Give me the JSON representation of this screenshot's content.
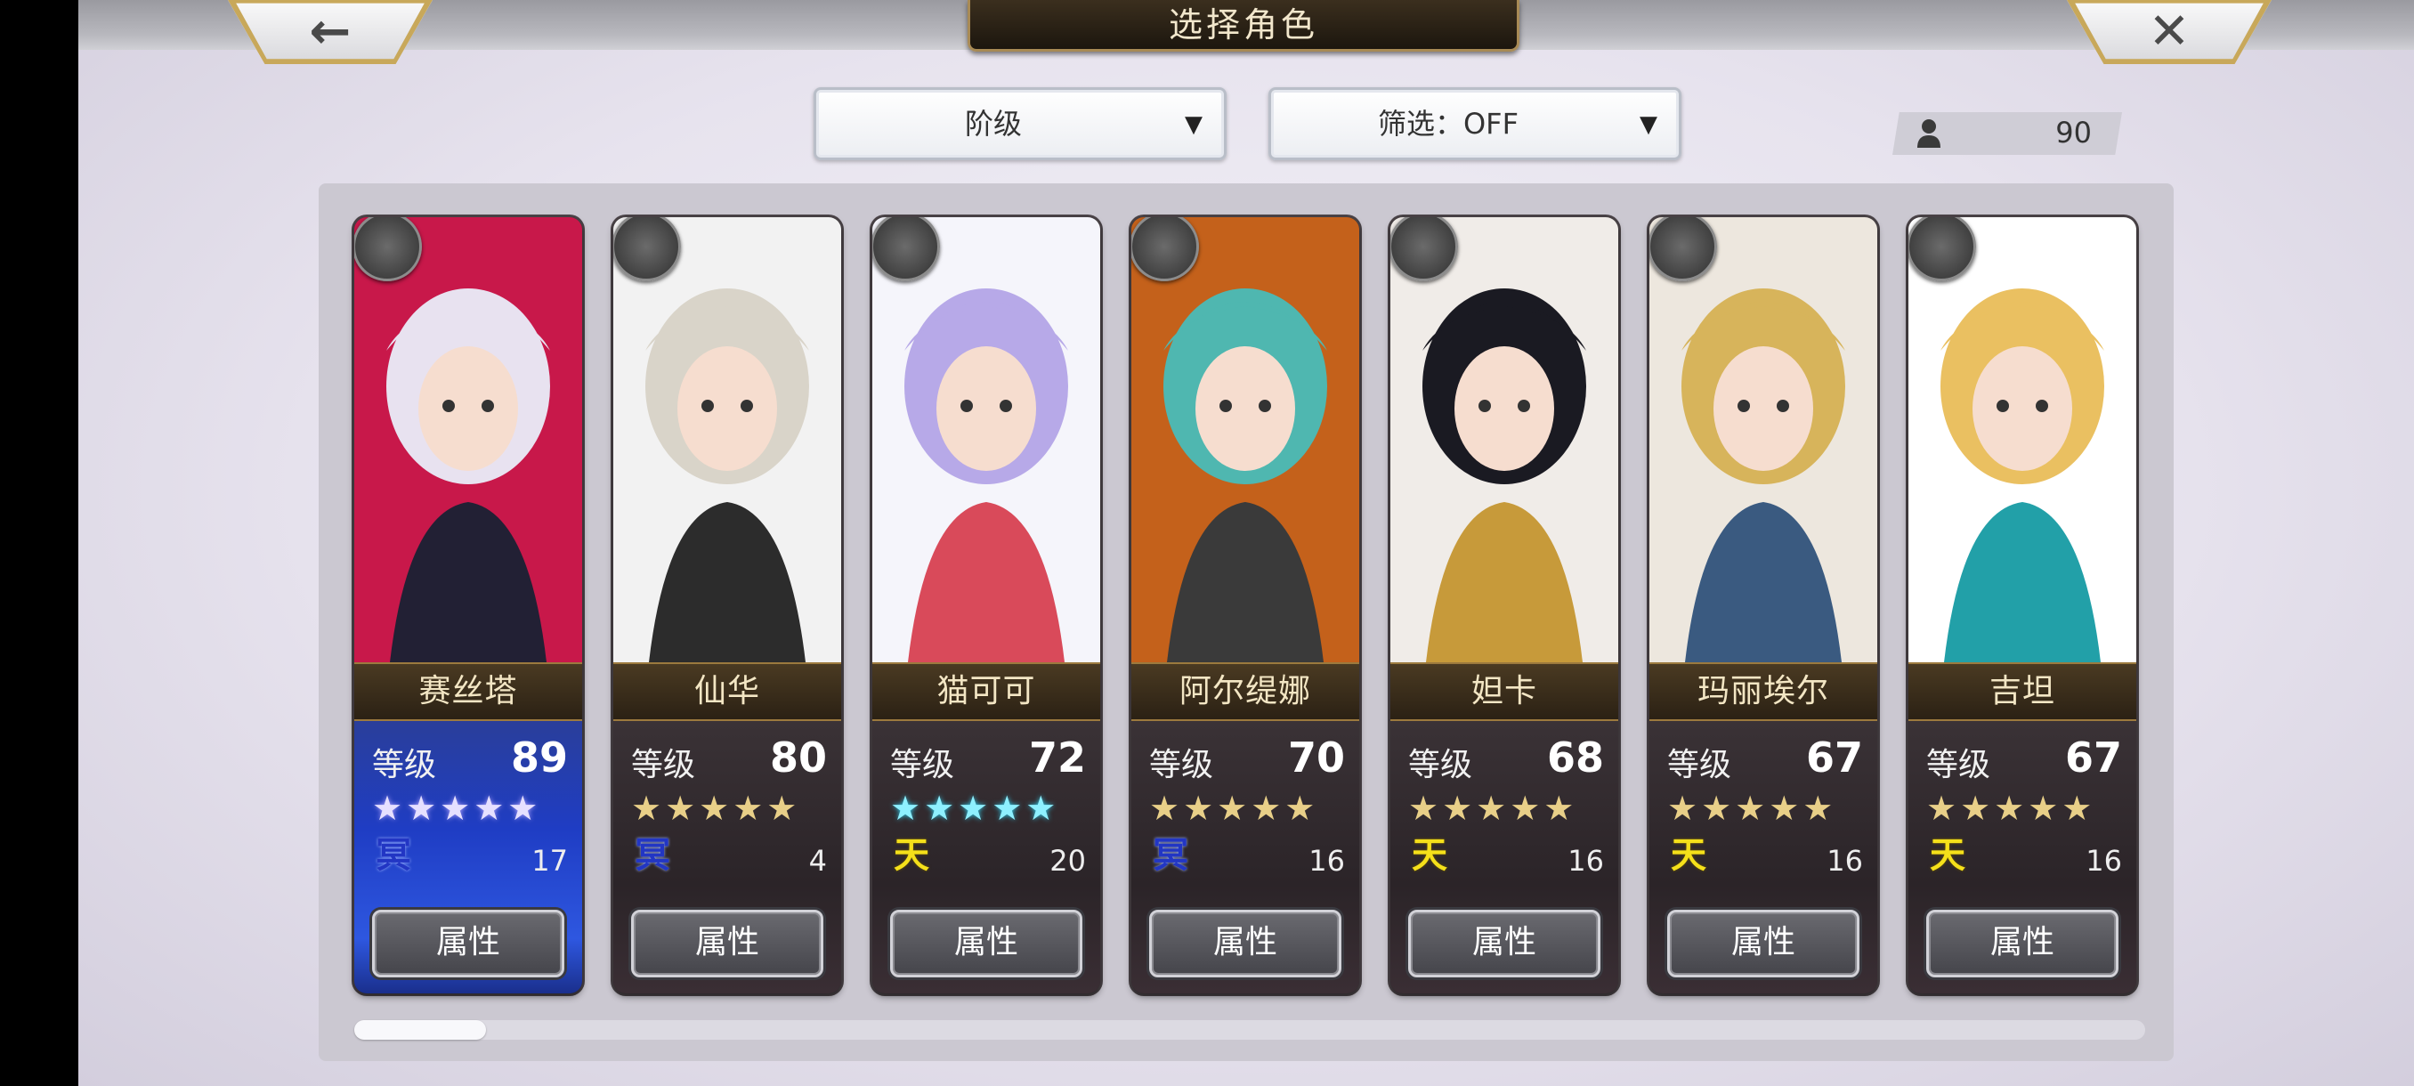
{
  "header": {
    "title": "选择角色",
    "back_icon": "back-arrow-icon",
    "close_icon": "close-x-icon"
  },
  "toolbar": {
    "sort_dropdown": {
      "selected": "阶级"
    },
    "filter_dropdown": {
      "selected": "筛选：OFF"
    },
    "roster_count": "90"
  },
  "colors": {
    "name_plate_text": "#f3e6c4",
    "heaven_element": "#f5e01a",
    "dark_element": "#2236c4",
    "cyan_star": "#8ef0ff",
    "gold_star": "#e8cf88"
  },
  "characters": [
    {
      "name": "赛丝塔",
      "level_label": "等级",
      "level": "89",
      "stars": "★★★★★",
      "star_color": "white",
      "element": "冥",
      "element_type": "dark",
      "element_count": "17",
      "attribute_label": "属性",
      "role_icon": "sword-icon"
    },
    {
      "name": "仙华",
      "level_label": "等级",
      "level": "80",
      "stars": "★★★★★",
      "star_color": "gold",
      "element": "冥",
      "element_type": "dark",
      "element_count": "4",
      "attribute_label": "属性",
      "role_icon": "staff-icon"
    },
    {
      "name": "猫可可",
      "level_label": "等级",
      "level": "72",
      "stars": "★★★★★",
      "star_color": "cyan",
      "element": "天",
      "element_type": "heaven",
      "element_count": "20",
      "attribute_label": "属性",
      "role_icon": "bow-icon"
    },
    {
      "name": "阿尔缇娜",
      "level_label": "等级",
      "level": "70",
      "stars": "★★★★★",
      "star_color": "gold",
      "element": "冥",
      "element_type": "dark",
      "element_count": "16",
      "attribute_label": "属性",
      "role_icon": "bow-icon"
    },
    {
      "name": "妲卡",
      "level_label": "等级",
      "level": "68",
      "stars": "★★★★★",
      "star_color": "gold",
      "element": "天",
      "element_type": "heaven",
      "element_count": "16",
      "attribute_label": "属性",
      "role_icon": "staff-icon"
    },
    {
      "name": "玛丽埃尔",
      "level_label": "等级",
      "level": "67",
      "stars": "★★★★★",
      "star_color": "gold",
      "element": "天",
      "element_type": "heaven",
      "element_count": "16",
      "attribute_label": "属性",
      "role_icon": "staff-icon"
    },
    {
      "name": "吉坦",
      "level_label": "等级",
      "level": "67",
      "stars": "★★★★★",
      "star_color": "gold",
      "element": "天",
      "element_type": "heaven",
      "element_count": "16",
      "attribute_label": "属性",
      "role_icon": "sword-icon"
    }
  ],
  "scrollbar": {
    "position_fraction": 0.0
  }
}
